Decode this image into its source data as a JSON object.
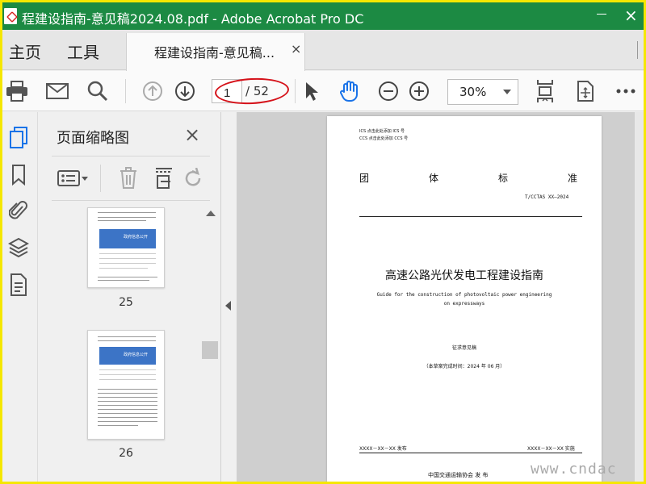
{
  "window": {
    "title": "程建设指南-意见稿2024.08.pdf - Adobe Acrobat Pro DC",
    "title_bg": "#1c8a43"
  },
  "menu": {
    "home": "主页",
    "tools": "工具"
  },
  "doc_tab": {
    "label": "程建设指南-意见稿...",
    "close": "×"
  },
  "toolbar": {
    "current_page": "1",
    "total_pages": "/ 52",
    "zoom": "30%",
    "icons": [
      "printer-icon",
      "mail-icon",
      "search-icon",
      "page-up-icon",
      "page-down-icon",
      "select-cursor-icon",
      "hand-tool-icon",
      "zoom-out-icon",
      "zoom-in-icon",
      "fit-page-icon",
      "rotate-view-icon",
      "more-icon"
    ]
  },
  "left_rail": {
    "icons": [
      "page-thumbnails-icon",
      "bookmark-icon",
      "attachment-icon",
      "layers-icon",
      "document-properties-icon"
    ]
  },
  "thumb_panel": {
    "title": "页面缩略图",
    "close": "×",
    "thumbnails": [
      {
        "page": "25",
        "banner_text": "政府信息公开"
      },
      {
        "page": "26",
        "banner_text": "政府信息公开"
      }
    ]
  },
  "document": {
    "ics_line": "ICS   点击此处添加 ICS 号",
    "ccs_line": "CCS   点击此处添加 CCS 号",
    "std_type_chars": [
      "团",
      "体",
      "标",
      "准"
    ],
    "std_number": "T/CCTAS XX—2024",
    "title_cn": "高速公路光伏发电工程建设指南",
    "title_en_line1": "Guide for the construction of photovoltaic power engineering",
    "title_en_line2": "on expressways",
    "draft_label": "征求意见稿",
    "completion_note": "（本草案完成时间：2024 年 06 月）",
    "issue_date": "XXXX－XX－XX 发布",
    "implement_date": "XXXX－XX－XX 实施",
    "organization": "中国交通运输协会    发 布"
  },
  "watermark": "www.cndac",
  "accent_colors": {
    "annotation_red": "#d5121a",
    "hand_tool_blue": "#1a73e8",
    "banner_blue": "#3c74c6"
  }
}
